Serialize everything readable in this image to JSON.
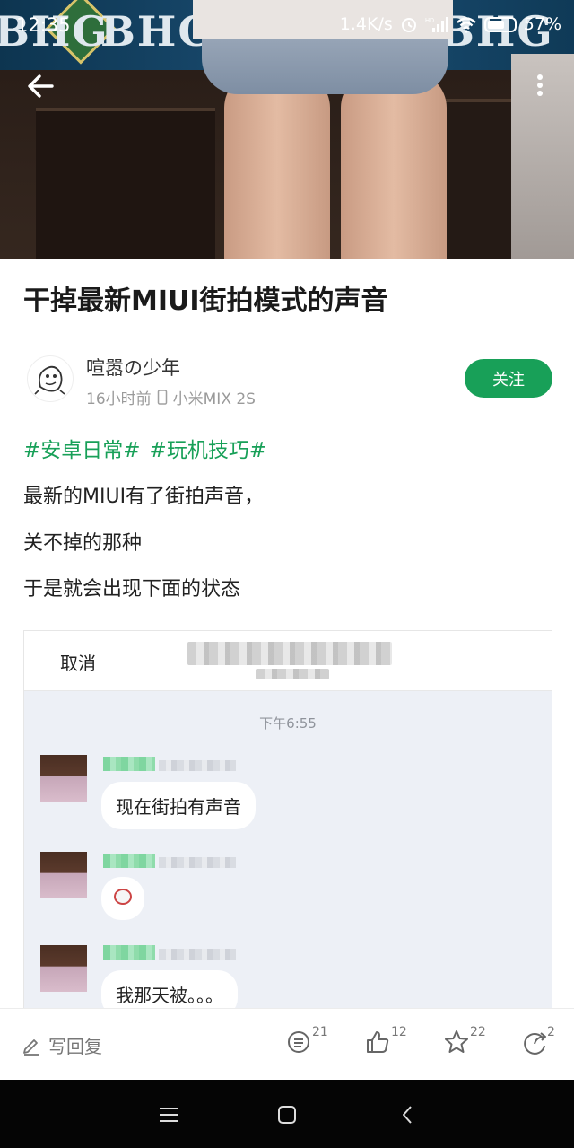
{
  "status_bar": {
    "time": "12:35",
    "net_speed": "1.4K/s",
    "battery": "57%"
  },
  "hero": {
    "sign_text": "BHG"
  },
  "article": {
    "title": "干掉最新MIUI街拍模式的声音",
    "author": {
      "name": "喧嚣の少年",
      "time": "16小时前",
      "device": "小米MIX 2S"
    },
    "follow_label": "关注",
    "tags": [
      "#安卓日常#",
      "#玩机技巧#"
    ],
    "paragraphs": [
      "最新的MIUI有了街拍声音，",
      "关不掉的那种",
      "于是就会出现下面的状态"
    ]
  },
  "embed": {
    "cancel_label": "取消",
    "time_label": "下午6:55",
    "messages": [
      {
        "text": "现在街拍有声音"
      },
      {
        "text": ""
      },
      {
        "text": "我那天被。。。"
      }
    ]
  },
  "action_bar": {
    "reply_label": "写回复",
    "comments": "21",
    "likes": "12",
    "favorites": "22",
    "shares": "2"
  },
  "colors": {
    "accent": "#18a058"
  }
}
